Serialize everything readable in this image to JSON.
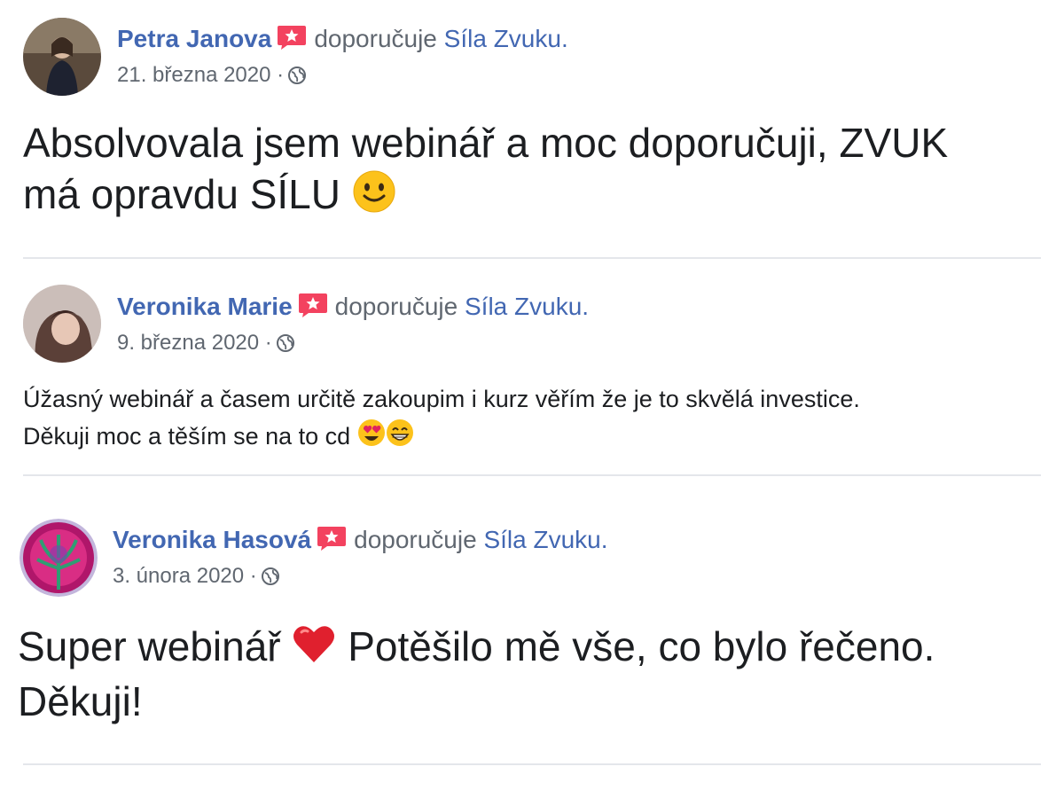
{
  "recommends_text": "doporučuje",
  "reviews": [
    {
      "author": "Petra Janova",
      "page": "Síla Zvuku.",
      "date": "21. března 2020",
      "separator": "·",
      "line1": "Absolvovala jsem webinář a moc doporučuji, ZVUK",
      "line2": "má opravdu SÍLU",
      "emoji": [
        "slightly-smiling-face"
      ]
    },
    {
      "author": "Veronika Marie",
      "page": "Síla Zvuku.",
      "date": "9. března 2020",
      "separator": "·",
      "line1": "Úžasný webinář a časem určitě zakoupim i kurz věřím že je to skvělá investice.",
      "line2": "Děkuji moc a těším se na to cd",
      "emoji": [
        "heart-eyes-face",
        "grinning-face"
      ]
    },
    {
      "author": "Veronika Hasová",
      "page": "Síla Zvuku.",
      "date": "3. února 2020",
      "separator": "·",
      "line1a": "Super webinář",
      "line1b": "Potěšilo mě vše, co bylo řečeno.",
      "line2": "Děkuji!",
      "emoji": [
        "red-heart"
      ]
    }
  ],
  "colors": {
    "link": "#4267b2",
    "secondary": "#606770",
    "badge": "#f3425f",
    "divider": "#e4e6eb"
  }
}
